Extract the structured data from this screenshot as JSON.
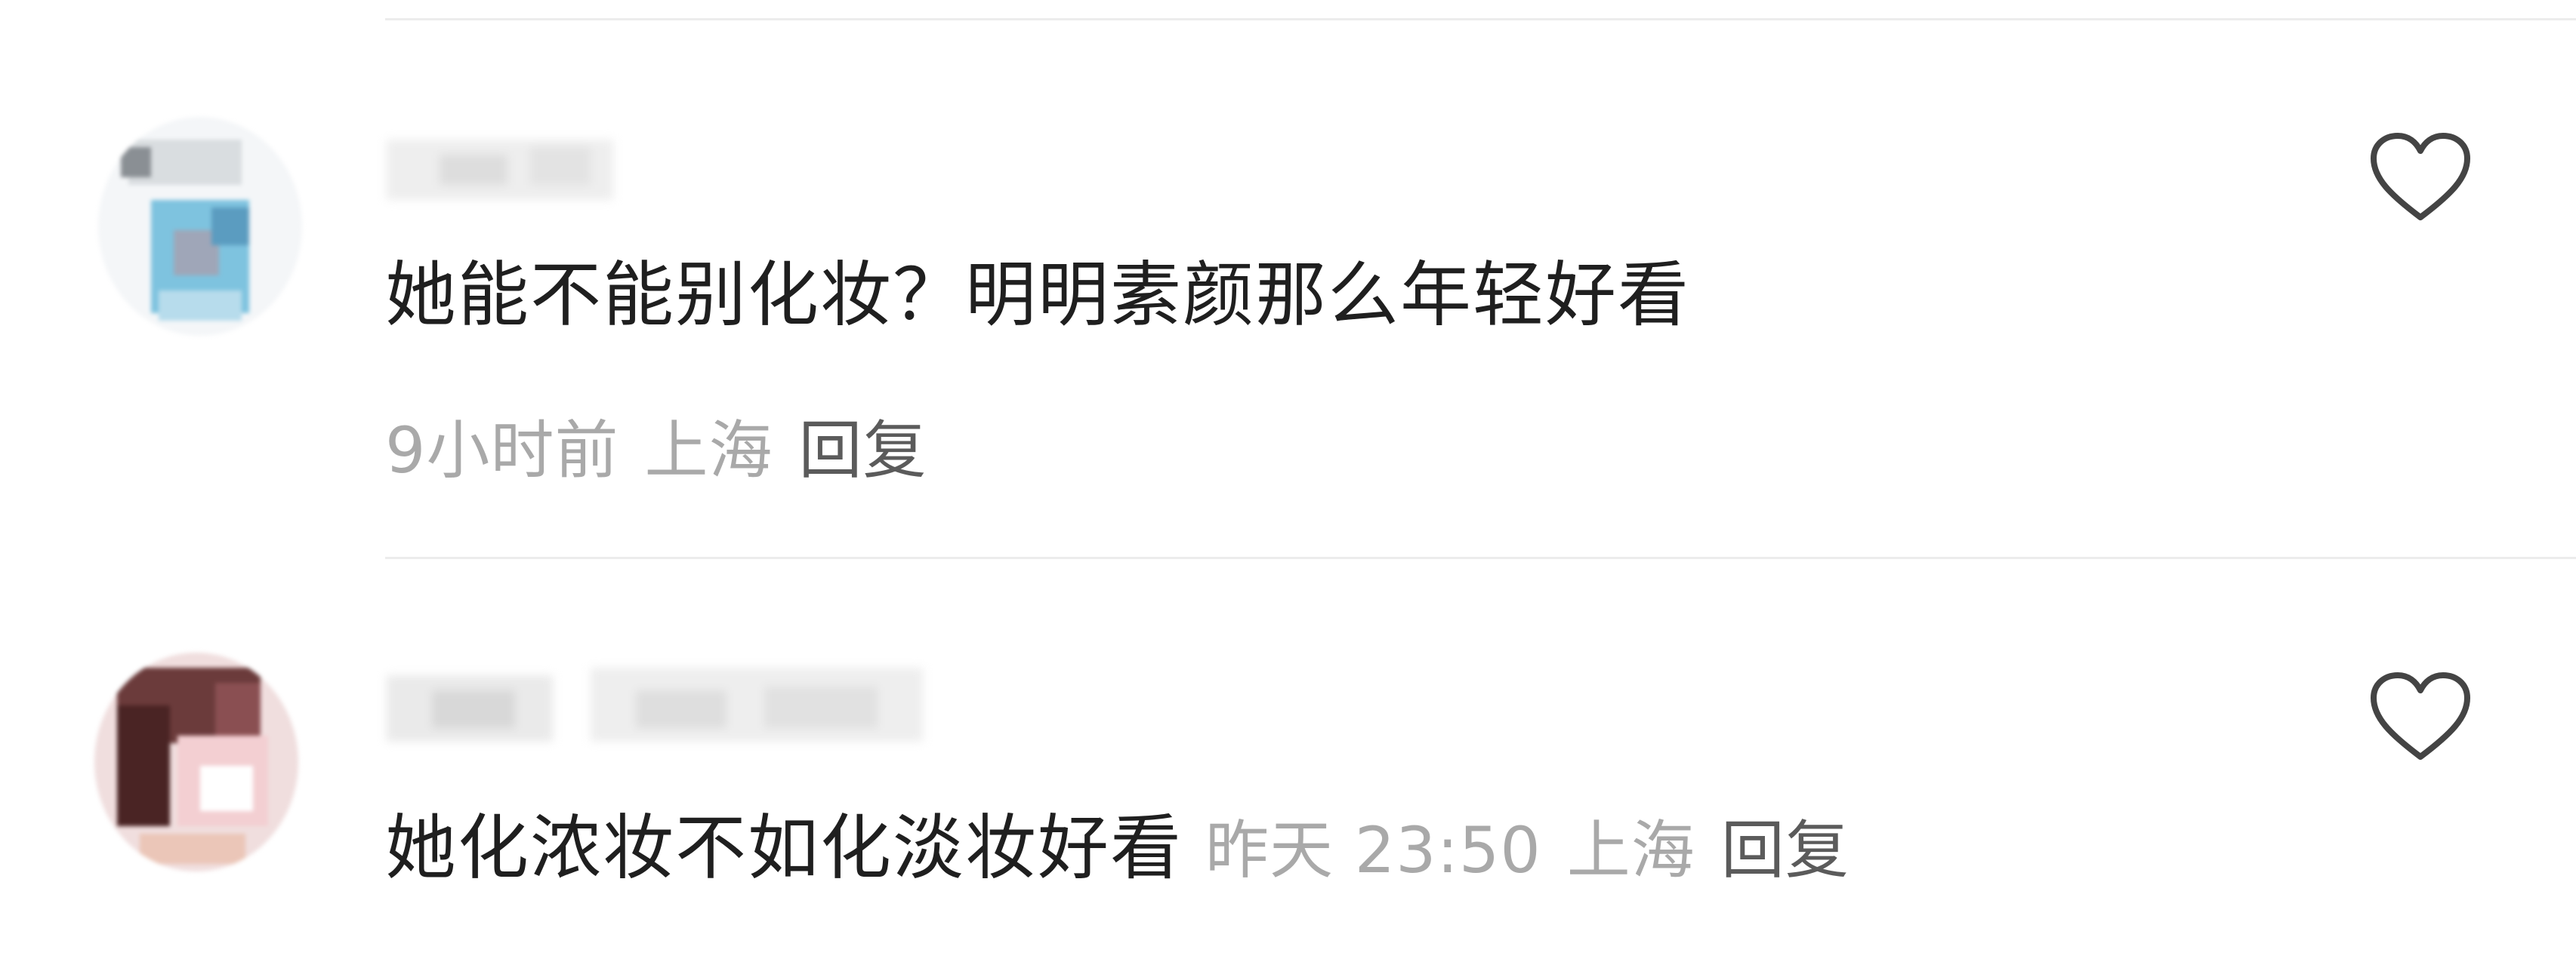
{
  "comments": [
    {
      "text": "她能不能别化妆？明明素颜那么年轻好看",
      "time": "9小时前",
      "location": "上海",
      "reply_label": "回复"
    },
    {
      "text": "她化浓妆不如化淡妆好看",
      "time": "昨天 23:50",
      "location": "上海",
      "reply_label": "回复"
    }
  ],
  "icons": {
    "like": "heart-outline-icon"
  },
  "colors": {
    "content_text": "#1f1f1f",
    "meta_text": "#a9a9a9",
    "reply_text": "#5b5b5b",
    "divider": "#ececec"
  }
}
